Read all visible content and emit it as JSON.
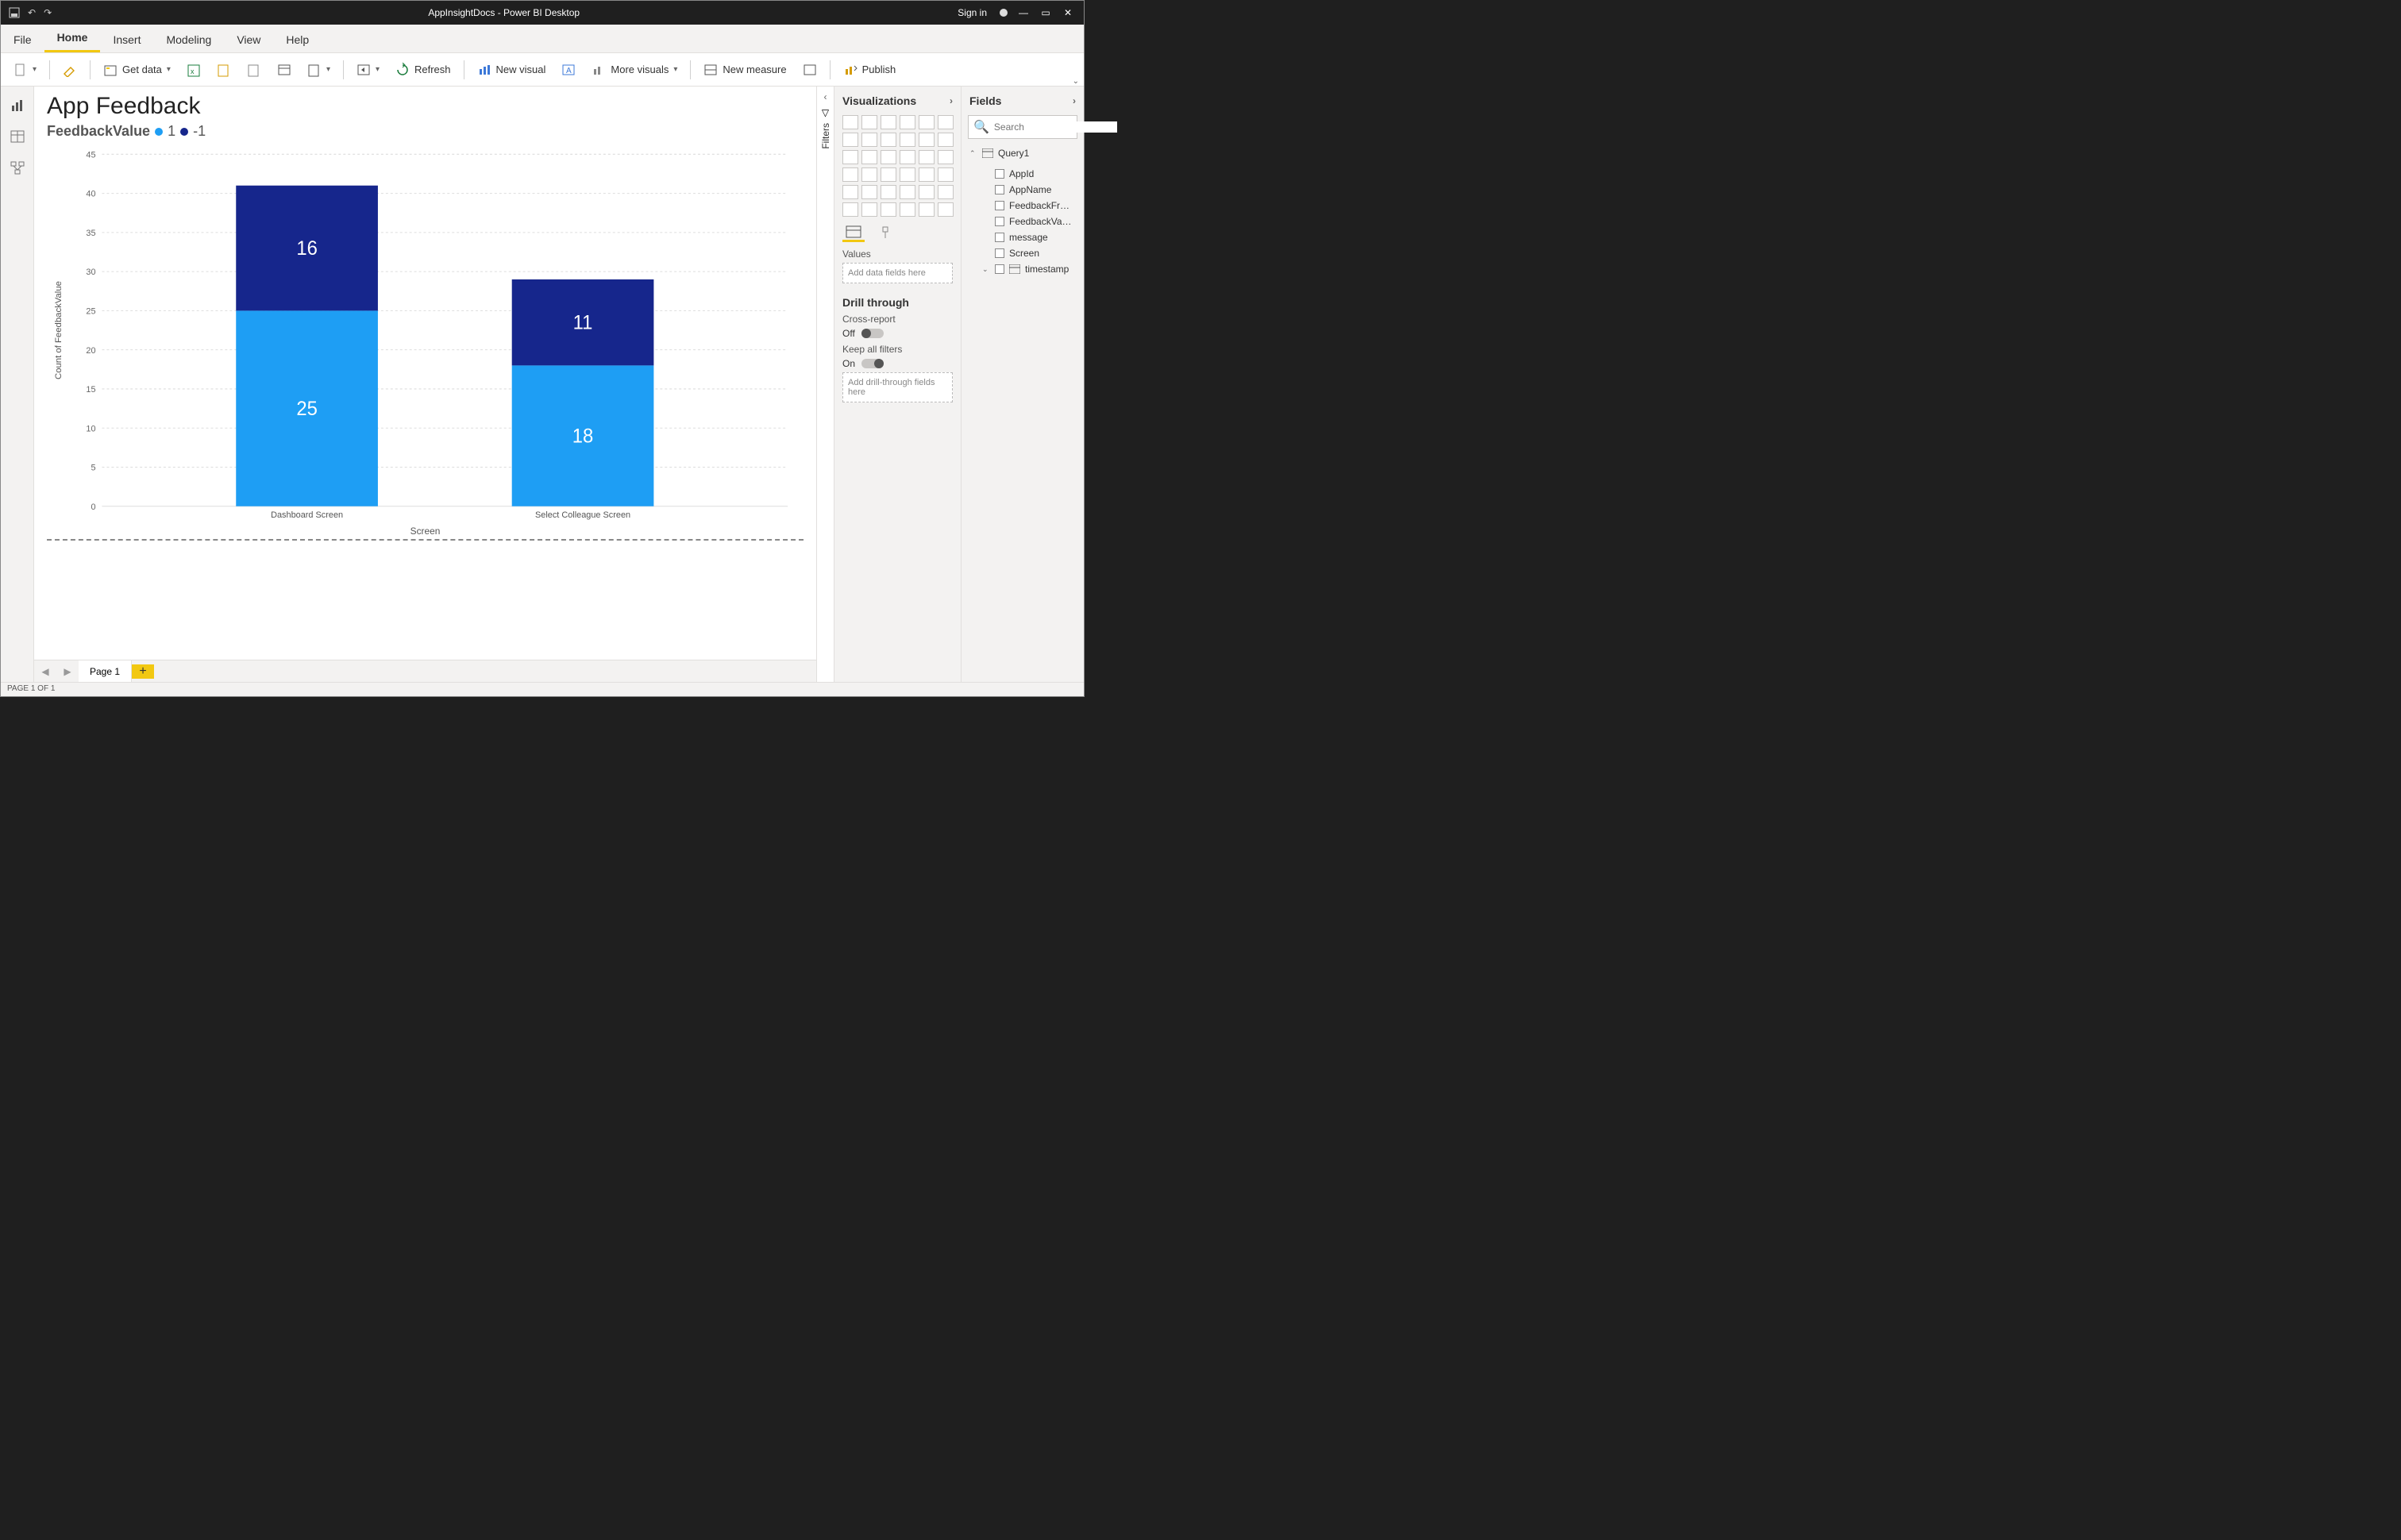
{
  "window": {
    "title": "AppInsightDocs - Power BI Desktop",
    "signin": "Sign in"
  },
  "menu": {
    "file": "File",
    "home": "Home",
    "insert": "Insert",
    "modeling": "Modeling",
    "view": "View",
    "help": "Help"
  },
  "ribbon": {
    "get_data": "Get data",
    "refresh": "Refresh",
    "new_visual": "New visual",
    "more_visuals": "More visuals",
    "new_measure": "New measure",
    "publish": "Publish"
  },
  "report": {
    "title": "App Feedback",
    "legend_title": "FeedbackValue",
    "legend_a": "1",
    "legend_b": "-1"
  },
  "chart_data": {
    "type": "bar",
    "stacked": true,
    "title": "App Feedback",
    "legend_field": "FeedbackValue",
    "categories": [
      "Dashboard Screen",
      "Select Colleague Screen"
    ],
    "series": [
      {
        "name": "1",
        "color": "#1e9ef4",
        "values": [
          25,
          18
        ]
      },
      {
        "name": "-1",
        "color": "#16268c",
        "values": [
          16,
          11
        ]
      }
    ],
    "totals": [
      41,
      29
    ],
    "ylabel": "Count of FeedbackValue",
    "xlabel": "Screen",
    "ylim": [
      0,
      45
    ],
    "yticks": [
      0,
      5,
      10,
      15,
      20,
      25,
      30,
      35,
      40,
      45
    ]
  },
  "filters": {
    "label": "Filters"
  },
  "viz": {
    "header": "Visualizations",
    "values_label": "Values",
    "values_well": "Add data fields here",
    "drill_header": "Drill through",
    "cross_report": "Cross-report",
    "off": "Off",
    "keep_filters": "Keep all filters",
    "on": "On",
    "drill_well": "Add drill-through fields here"
  },
  "fields": {
    "header": "Fields",
    "search_ph": "Search",
    "table": "Query1",
    "cols": [
      "AppId",
      "AppName",
      "FeedbackFr…",
      "FeedbackVa…",
      "message",
      "Screen",
      "timestamp"
    ]
  },
  "pages": {
    "name": "Page 1"
  },
  "status": "PAGE 1 OF 1"
}
